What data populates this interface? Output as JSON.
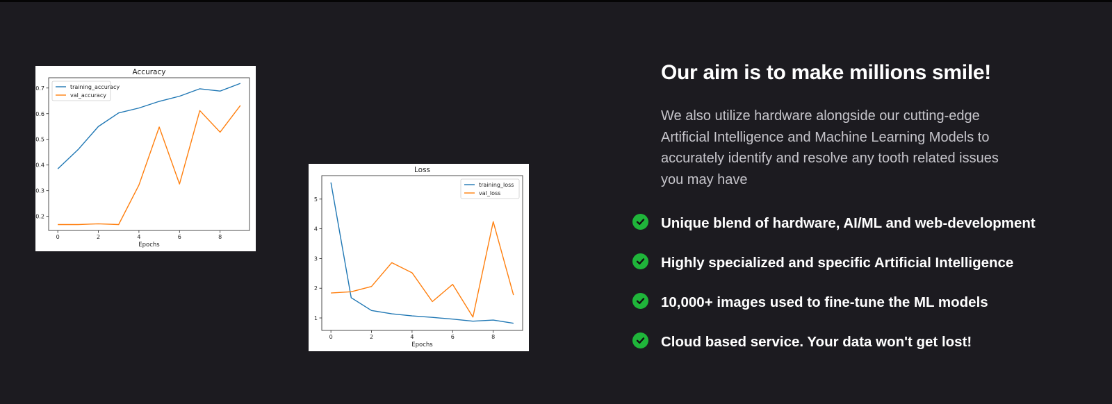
{
  "headline": "Our aim is to make millions smile!",
  "description": "We also utilize hardware alongside our cutting-edge Artificial Intelligence and Machine Learning Models to accurately identify and resolve any tooth related issues you may have",
  "features": [
    {
      "label": "Unique blend of hardware, AI/ML and web-development",
      "icon": "check-circle-icon"
    },
    {
      "label": "Highly specialized and specific Artificial Intelligence",
      "icon": "check-circle-icon"
    },
    {
      "label": "10,000+ images used to fine-tune the ML models",
      "icon": "check-circle-icon"
    },
    {
      "label": "Cloud based service. Your data won't get lost!",
      "icon": "check-circle-icon"
    }
  ],
  "colors": {
    "background": "#1c1b20",
    "heading": "#ffffff",
    "body_text": "#c6c5cb",
    "check": "#1fb53a",
    "training_series": "#1f77b4",
    "val_series": "#ff7f0e"
  },
  "chart_data": [
    {
      "type": "line",
      "title": "Accuracy",
      "xlabel": "Epochs",
      "ylabel": "",
      "x": [
        0,
        1,
        2,
        3,
        4,
        5,
        6,
        7,
        8,
        9
      ],
      "xticks": [
        0,
        2,
        4,
        6,
        8
      ],
      "yticks": [
        0.2,
        0.3,
        0.4,
        0.5,
        0.6,
        0.7
      ],
      "xlim": [
        -0.45,
        9.45
      ],
      "ylim": [
        0.145,
        0.74
      ],
      "legend": "top-left",
      "series": [
        {
          "name": "training_accuracy",
          "color": "#1f77b4",
          "values": [
            0.385,
            0.46,
            0.55,
            0.603,
            0.622,
            0.648,
            0.668,
            0.697,
            0.688,
            0.718
          ]
        },
        {
          "name": "val_accuracy",
          "color": "#ff7f0e",
          "values": [
            0.168,
            0.168,
            0.171,
            0.168,
            0.322,
            0.548,
            0.326,
            0.612,
            0.528,
            0.632
          ]
        }
      ]
    },
    {
      "type": "line",
      "title": "Loss",
      "xlabel": "Epochs",
      "ylabel": "",
      "x": [
        0,
        1,
        2,
        3,
        4,
        5,
        6,
        7,
        8,
        9
      ],
      "xticks": [
        0,
        2,
        4,
        6,
        8
      ],
      "yticks": [
        1,
        2,
        3,
        4,
        5
      ],
      "xlim": [
        -0.45,
        9.45
      ],
      "ylim": [
        0.58,
        5.79
      ],
      "legend": "top-right",
      "series": [
        {
          "name": "training_loss",
          "color": "#1f77b4",
          "values": [
            5.56,
            1.68,
            1.25,
            1.14,
            1.07,
            1.02,
            0.96,
            0.89,
            0.93,
            0.82
          ]
        },
        {
          "name": "val_loss",
          "color": "#ff7f0e",
          "values": [
            1.84,
            1.88,
            2.06,
            2.86,
            2.52,
            1.55,
            2.13,
            1.03,
            4.24,
            1.77
          ]
        }
      ]
    }
  ]
}
